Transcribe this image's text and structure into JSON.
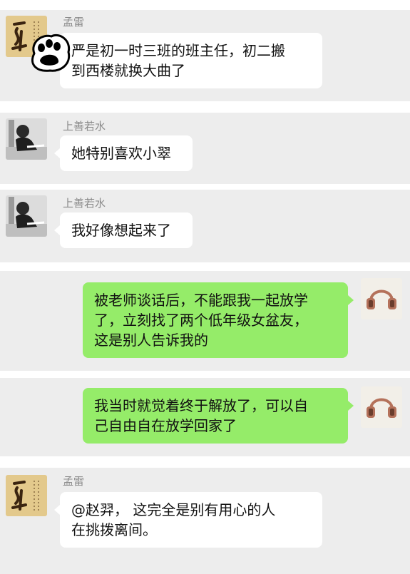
{
  "messages": [
    {
      "sender": "孟雷",
      "direction": "incoming",
      "avatar": "calligraphy-seal-avatar",
      "text": "严是初一时三班的班主任，初二搬\n到西楼就换大曲了"
    },
    {
      "sender": "上善若水",
      "direction": "incoming",
      "avatar": "person-at-desk-avatar",
      "text": "她特别喜欢小翠"
    },
    {
      "sender": "上善若水",
      "direction": "incoming",
      "avatar": "person-at-desk-avatar",
      "text": "我好像想起来了"
    },
    {
      "direction": "outgoing",
      "avatar": "headphones-avatar",
      "text": "被老师谈话后，不能跟我一起放学\n了，立刻找了两个低年级女盆友，\n这是别人告诉我的"
    },
    {
      "direction": "outgoing",
      "avatar": "headphones-avatar",
      "text": "我当时就觉着终于解放了，可以自\n己自由自在放学回家了"
    },
    {
      "sender": "孟雷",
      "direction": "incoming",
      "avatar": "calligraphy-seal-avatar",
      "text": "@赵羿， 这完全是别有用心的人\n在挑拨离间。"
    }
  ],
  "colors": {
    "panel_background": "#ededed",
    "incoming_bubble": "#ffffff",
    "outgoing_bubble": "#95ec69",
    "sender_name": "#8a8a8a"
  },
  "decorations": {
    "sticker": "paw-print-sticker"
  }
}
